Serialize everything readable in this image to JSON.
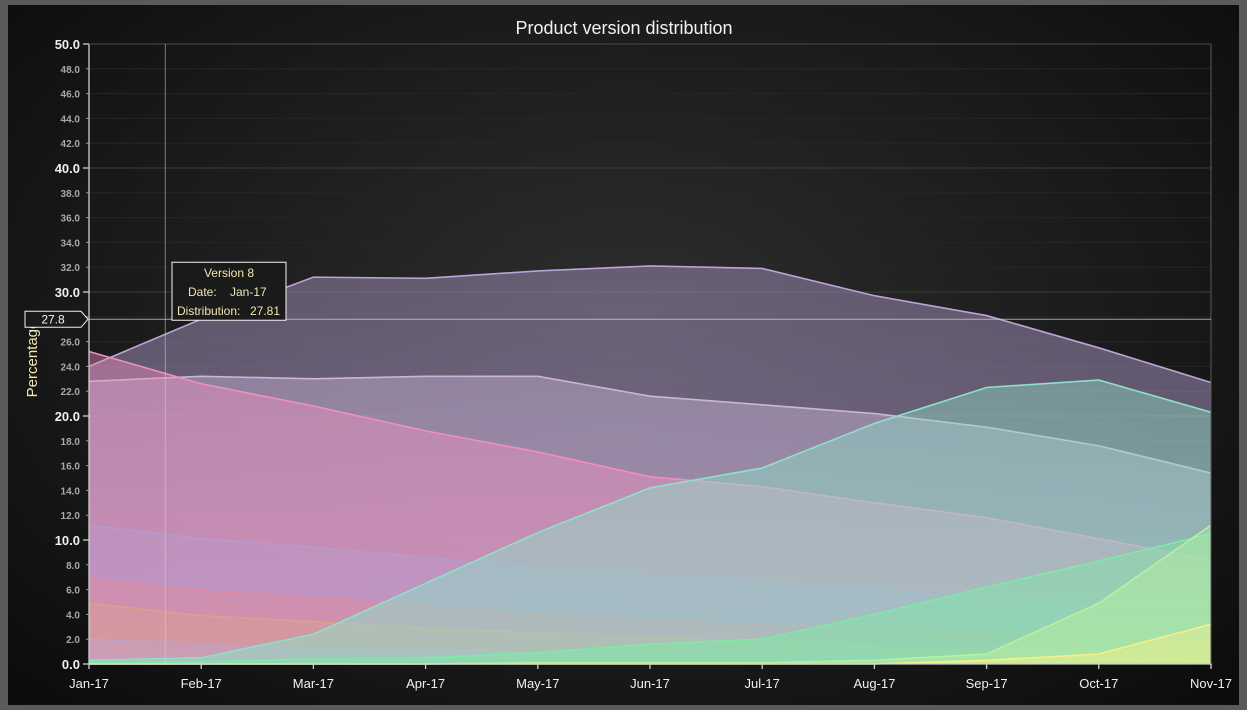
{
  "chart_data": {
    "type": "area",
    "title": "Product version distribution",
    "xlabel": "",
    "ylabel": "Percentage",
    "x": [
      "Jan-17",
      "Feb-17",
      "Mar-17",
      "Apr-17",
      "May-17",
      "Jun-17",
      "Jul-17",
      "Aug-17",
      "Sep-17",
      "Oct-17",
      "Nov-17"
    ],
    "ylim": [
      0,
      50
    ],
    "y_major_ticks": [
      "0.0",
      "10.0",
      "20.0",
      "30.0",
      "40.0",
      "50.0"
    ],
    "y_minor_ticks": [
      "2.0",
      "4.0",
      "6.0",
      "8.0",
      "12.0",
      "14.0",
      "16.0",
      "18.0",
      "22.0",
      "24.0",
      "26.0",
      "28.0",
      "32.0",
      "34.0",
      "36.0",
      "38.0",
      "42.0",
      "44.0",
      "46.0",
      "48.0"
    ],
    "grid": true,
    "legend": "none",
    "series": [
      {
        "name": "Version 8",
        "color": "#b9a4d6",
        "values": [
          24.0,
          27.81,
          31.2,
          31.1,
          31.7,
          32.1,
          31.9,
          29.7,
          28.1,
          25.5,
          22.7
        ]
      },
      {
        "color": "#cbb5d8",
        "values": [
          22.8,
          23.2,
          23.0,
          23.2,
          23.2,
          21.6,
          20.9,
          20.2,
          19.1,
          17.6,
          15.4
        ]
      },
      {
        "color": "#f08fbf",
        "values": [
          25.2,
          22.6,
          20.8,
          18.8,
          17.1,
          15.1,
          14.3,
          13.0,
          11.8,
          10.1,
          8.4
        ]
      },
      {
        "color": "#b79acb",
        "values": [
          11.2,
          10.1,
          9.4,
          8.6,
          7.7,
          7.1,
          6.6,
          6.0,
          5.3,
          4.6,
          3.8
        ]
      },
      {
        "color": "#e08a9e",
        "values": [
          6.8,
          5.9,
          5.3,
          4.6,
          4.0,
          3.5,
          3.1,
          2.8,
          2.5,
          2.2,
          1.9
        ]
      },
      {
        "color": "#d9a08f",
        "values": [
          4.9,
          3.9,
          3.4,
          2.9,
          2.5,
          2.1,
          1.8,
          1.5,
          1.3,
          1.1,
          0.9
        ]
      },
      {
        "color": "#c0a2c8",
        "values": [
          2.0,
          1.6,
          1.3,
          1.1,
          0.9,
          0.8,
          0.7,
          0.6,
          0.5,
          0.4,
          0.3
        ]
      },
      {
        "color": "#8fe0c8",
        "values": [
          0.3,
          0.5,
          2.4,
          6.5,
          10.6,
          14.2,
          15.8,
          19.4,
          22.3,
          22.9,
          20.3
        ]
      },
      {
        "color": "#7fe9a6",
        "values": [
          0.1,
          0.2,
          0.4,
          0.5,
          0.9,
          1.6,
          2.0,
          4.0,
          6.2,
          8.3,
          10.5
        ]
      },
      {
        "color": "#b7f0a0",
        "values": [
          0.0,
          0.0,
          0.0,
          0.0,
          0.1,
          0.1,
          0.1,
          0.3,
          0.8,
          4.9,
          11.2
        ]
      },
      {
        "color": "#f4f08a",
        "values": [
          0.0,
          0.0,
          0.0,
          0.0,
          0.0,
          0.0,
          0.0,
          0.0,
          0.3,
          0.8,
          3.2
        ]
      }
    ]
  },
  "crosshair": {
    "value_label": "27.8",
    "value": 27.8,
    "x_value": 0.68
  },
  "tooltip": {
    "series": "Version 8",
    "date_label": "Date:",
    "date_value": "Jan-17",
    "dist_label": "Distribution:",
    "dist_value": "27.81"
  },
  "colors": {
    "grid": "#3a3a3a",
    "axis": "#cfcfcf",
    "crosshair": "#d0d0d0",
    "tooltip_border": "#f5f5f5",
    "tooltip_bg": "#1a1a1a"
  }
}
